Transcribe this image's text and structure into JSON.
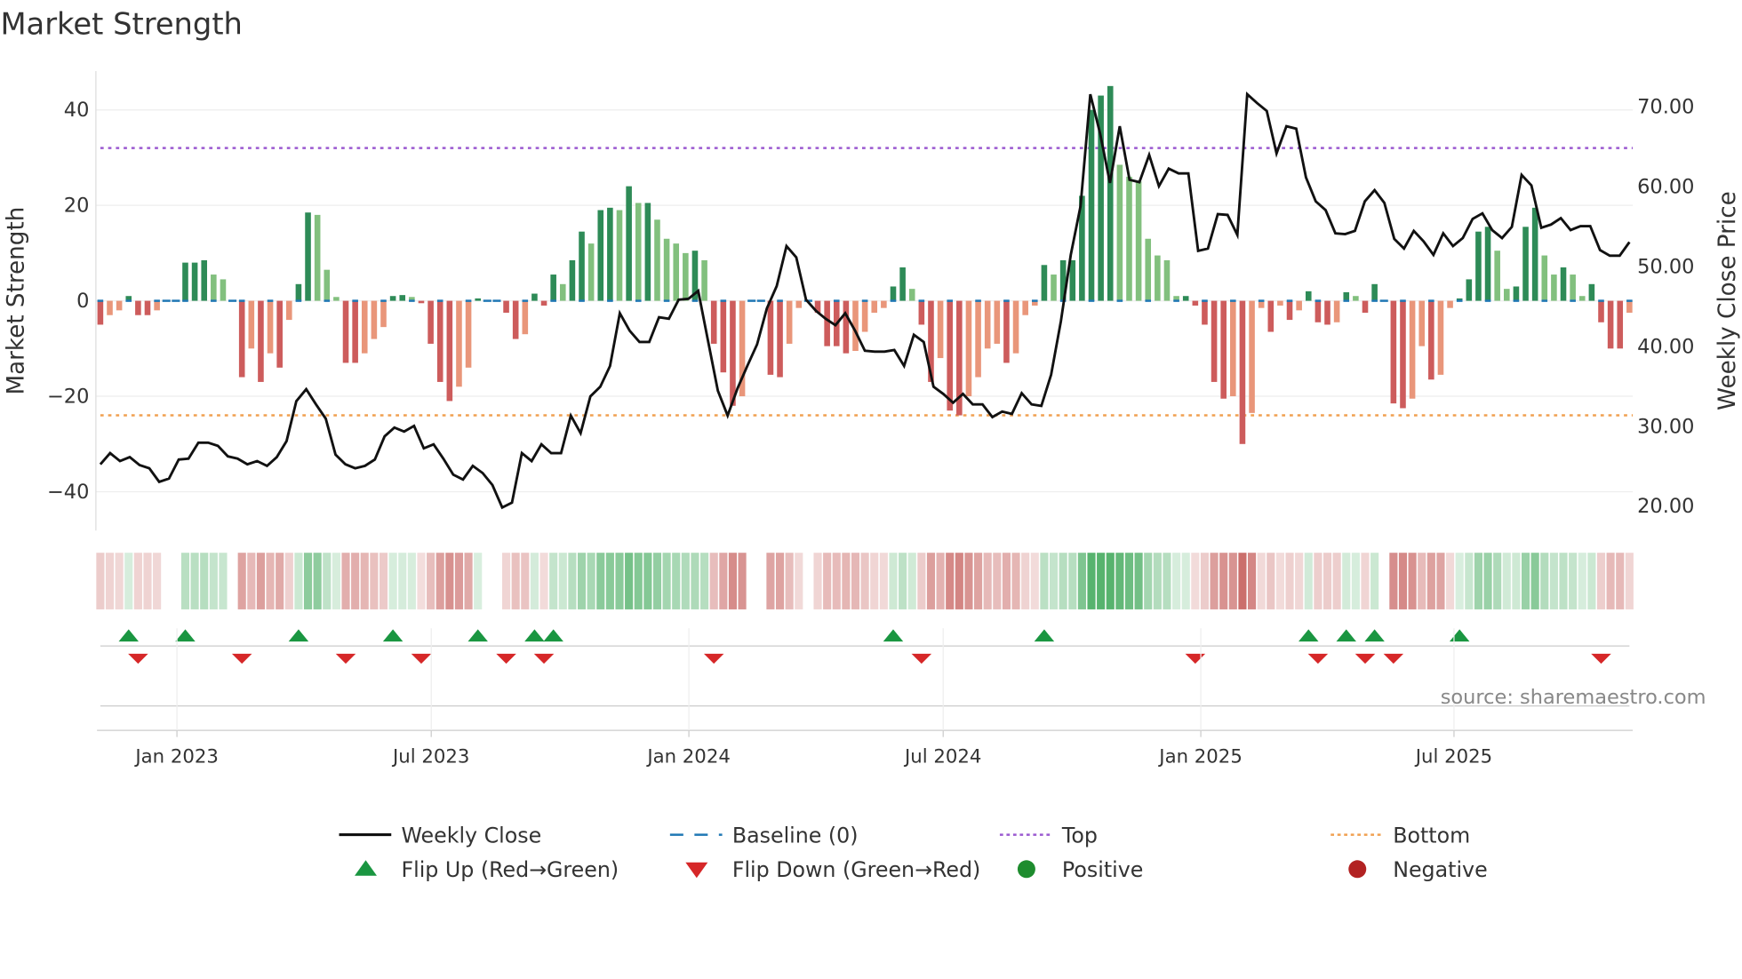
{
  "chart_data": {
    "type": "bar+line",
    "title": "Market Strength",
    "ylabel_left": "Market Strength",
    "ylabel_right": "Weekly Close Price",
    "ylim_left": [
      -48,
      48
    ],
    "ylim_right": [
      15.5,
      76
    ],
    "yticks_left": [
      40,
      20,
      0,
      -20,
      -40
    ],
    "yticks_left_labels": [
      "40",
      "20",
      "0",
      "−20",
      "−40"
    ],
    "yticks_right": [
      70,
      60,
      50,
      40,
      30,
      20
    ],
    "yticks_right_labels": [
      "70.00",
      "60.00",
      "50.00",
      "40.00",
      "30.00",
      "20.00"
    ],
    "xtick_labels": [
      "Jan 2023",
      "Jul 2023",
      "Jan 2024",
      "Jul 2024",
      "Jan 2025",
      "Jul 2025"
    ],
    "top_level": 32,
    "bottom_level": -24,
    "grid": true,
    "strength": [
      -5,
      -3,
      -2,
      1,
      -3,
      -3,
      -2,
      0,
      0,
      8,
      8,
      8.5,
      5.5,
      4.5,
      0,
      -16,
      -10,
      -17,
      -11,
      -14,
      -4,
      3.5,
      18.5,
      18,
      6.5,
      0.8,
      -13,
      -13,
      -11,
      -8,
      -5.5,
      1,
      1.2,
      0.8,
      -0.5,
      -9,
      -17,
      -21,
      -18,
      -14,
      0.5,
      0,
      0,
      -2.5,
      -8,
      -7,
      1.5,
      -1,
      5.5,
      3.5,
      8.5,
      14.5,
      12,
      19,
      19.5,
      19,
      24,
      20.5,
      20.5,
      17,
      13,
      12,
      10,
      10.5,
      8.5,
      -9,
      -15,
      -22,
      -20,
      0,
      0,
      -15.5,
      -16,
      -9,
      -1.5,
      0,
      -2.5,
      -9.5,
      -9.5,
      -11,
      -10.5,
      -6.5,
      -2.5,
      -1.5,
      3,
      7,
      2.5,
      -5,
      -17,
      -12,
      -23,
      -24,
      -20,
      -16,
      -10,
      -9,
      -13,
      -11,
      -3,
      -1,
      7.5,
      5.5,
      8.5,
      8.5,
      22,
      40,
      43,
      45,
      28.5,
      26,
      25,
      13,
      9.5,
      8.5,
      1,
      1,
      -1,
      -5,
      -17,
      -20.5,
      -20,
      -30,
      -23.5,
      -1.5,
      -6.5,
      -1,
      -4,
      -2,
      2,
      -4.5,
      -5,
      -4.5,
      1.8,
      1,
      -2.5,
      3.5,
      0,
      -21.5,
      -22.5,
      -20.5,
      -9.5,
      -16.5,
      -15.5,
      -1.5,
      0.5,
      4.5,
      14.5,
      15.5,
      10.5,
      2.5,
      3,
      15.5,
      19.5,
      9.5,
      5.5,
      7,
      5.5,
      1,
      3.5,
      -4.5,
      -10,
      -10,
      -2.5
    ],
    "weekly_close": [
      25.1,
      26.5,
      25.5,
      26,
      25,
      24.6,
      22.9,
      23.3,
      25.7,
      25.8,
      27.8,
      27.8,
      27.4,
      26.1,
      25.8,
      25.1,
      25.5,
      24.9,
      26,
      28,
      33,
      34.5,
      32.6,
      30.8,
      26.3,
      25.1,
      24.6,
      24.9,
      25.7,
      28.6,
      29.7,
      29.2,
      29.9,
      27.1,
      27.6,
      25.8,
      23.8,
      23.2,
      24.9,
      24,
      22.5,
      19.7,
      20.3,
      26.5,
      25.5,
      27.6,
      26.5,
      26.5,
      31.2,
      29,
      33.6,
      34.8,
      37.4,
      44,
      41.8,
      40.4,
      40.4,
      43.5,
      43.3,
      45.7,
      45.8,
      46.8,
      40.5,
      34.3,
      31.2,
      34.6,
      37.4,
      40.1,
      44.6,
      47.4,
      52.4,
      51,
      45.7,
      44.3,
      43.3,
      42.5,
      44,
      41.8,
      39.3,
      39.2,
      39.2,
      39.4,
      37.4,
      41.3,
      40.4,
      34.8,
      33.9,
      32.8,
      33.9,
      32.6,
      32.6,
      31,
      31.7,
      31.4,
      34,
      32.6,
      32.4,
      36.3,
      43,
      51.3,
      57.4,
      71.4,
      66.5,
      60.3,
      67.4,
      60.7,
      60.4,
      63.8,
      59.9,
      62.1,
      61.5,
      61.5,
      51.8,
      52.1,
      56.4,
      56.3,
      53.8,
      71.4,
      70.3,
      69.3,
      64,
      67.4,
      67.1,
      61,
      58,
      56.9,
      54,
      53.9,
      54.3,
      58,
      59.4,
      57.8,
      53.3,
      52.1,
      54.3,
      53,
      51.3,
      54,
      52.4,
      53.4,
      55.8,
      56.5,
      54.4,
      53.4,
      54.8,
      61.3,
      60,
      54.7,
      55.1,
      55.9,
      54.4,
      54.9,
      54.9,
      51.9,
      51.2,
      51.2,
      52.9
    ],
    "colors": {
      "pos_rising": "#2e8b57",
      "pos_falling": "#82c07e",
      "neg_falling": "#cd5c5c",
      "neg_rising": "#e9967a",
      "line": "#111111",
      "baseline": "#1f77b4",
      "top": "#9b59d0",
      "bottom": "#f0a050",
      "flip_up": "#1a9641",
      "flip_down": "#d62728"
    },
    "legend": {
      "placement": "bottom-center",
      "items": [
        "Weekly Close",
        "Baseline (0)",
        "Top",
        "Bottom",
        "Flip Up (Red→Green)",
        "Flip Down (Green→Red)",
        "Positive",
        "Negative"
      ]
    },
    "source": "source: sharemaestro.com"
  }
}
